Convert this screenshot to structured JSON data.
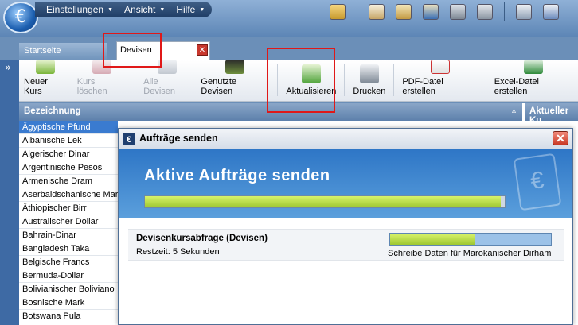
{
  "menu": {
    "items": [
      {
        "label_u": "E",
        "label": "instellungen"
      },
      {
        "label_u": "A",
        "label": "nsicht"
      },
      {
        "label_u": "H",
        "label": "ilfe"
      }
    ]
  },
  "tabs": {
    "start": "Startseite",
    "devisen": "Devisen"
  },
  "toolbar": {
    "neuer_kurs": "Neuer Kurs",
    "kurs_loeschen": "Kurs löschen",
    "alle_devisen": "Alle Devisen",
    "genutzte_devisen": "Genutzte Devisen",
    "aktualisieren": "Aktualisieren",
    "drucken": "Drucken",
    "pdf": "PDF-Datei erstellen",
    "excel": "Excel-Datei erstellen"
  },
  "table": {
    "col_name": "Bezeichnung",
    "col_kurs": "Aktueller Ku",
    "rows": [
      "Ägyptische Pfund",
      "Albanische Lek",
      "Algerischer Dinar",
      "Argentinische Pesos",
      "Armenische Dram",
      "Aserbaidschanische Mar",
      "Äthiopischer Birr",
      "Australischer Dollar",
      "Bahrain-Dinar",
      "Bangladesh Taka",
      "Belgische Francs",
      "Bermuda-Dollar",
      "Bolivianischer Boliviano",
      "Bosnische Mark",
      "Botswana Pula"
    ]
  },
  "dialog": {
    "title": "Aufträge senden",
    "heading": "Aktive Aufträge senden",
    "main_progress": 0.99,
    "task_title": "Devisenkursabfrage (Devisen)",
    "task_remaining": "Restzeit: 5 Sekunden",
    "task_progress": 0.53,
    "task_status": "Schreibe Daten für Marokanischer Dirham"
  },
  "colors": {
    "highlight": "#e01818",
    "progress_fill": "#b5dc44"
  }
}
